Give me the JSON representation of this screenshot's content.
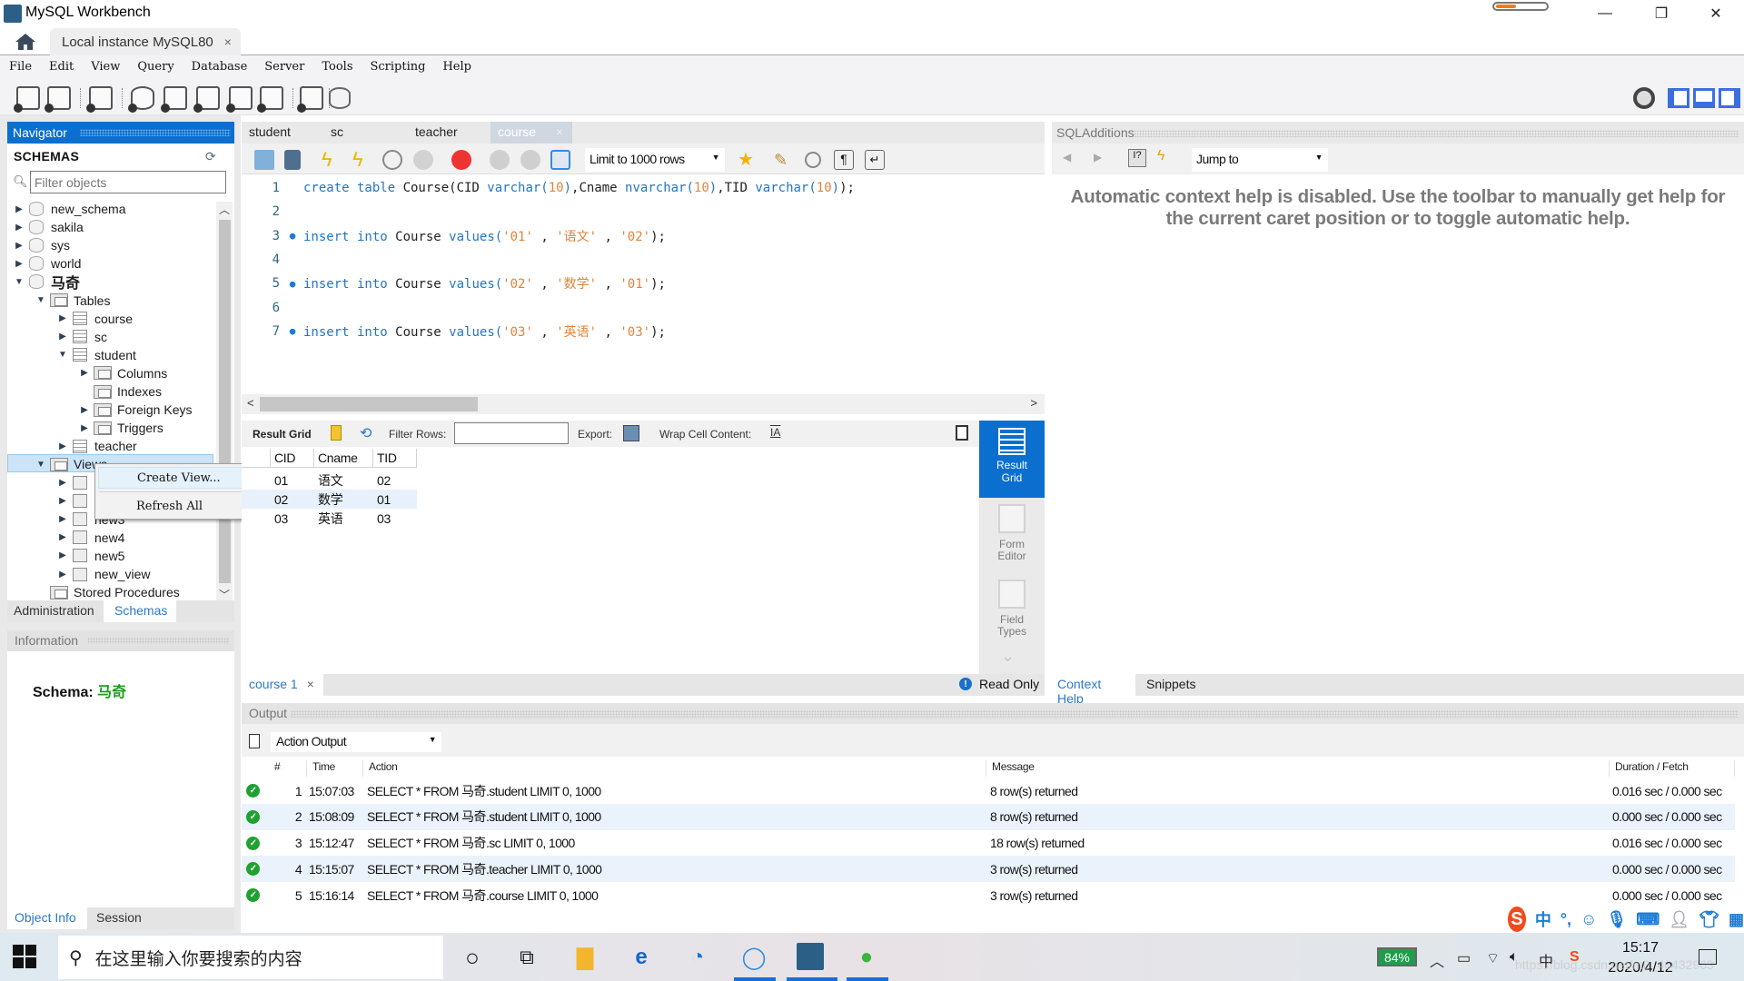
{
  "window": {
    "title": "MySQL Workbench",
    "progress_pct": 40,
    "minimize": "—",
    "restore": "❐",
    "close": "✕"
  },
  "connection_tab": {
    "label": "Local instance MySQL80",
    "close": "×"
  },
  "menu": [
    "File",
    "Edit",
    "View",
    "Query",
    "Database",
    "Server",
    "Tools",
    "Scripting",
    "Help"
  ],
  "navigator": {
    "header": "Navigator",
    "schemas_title": "SCHEMAS",
    "filter_placeholder": "Filter objects",
    "tree": [
      {
        "label": "new_schema",
        "level": 0,
        "expander": "▶",
        "icon": "database"
      },
      {
        "label": "sakila",
        "level": 0,
        "expander": "▶",
        "icon": "database"
      },
      {
        "label": "sys",
        "level": 0,
        "expander": "▶",
        "icon": "database"
      },
      {
        "label": "world",
        "level": 0,
        "expander": "▶",
        "icon": "database"
      },
      {
        "label": "马奇",
        "level": 0,
        "expander": "▼",
        "icon": "database",
        "bold": true
      },
      {
        "label": "Tables",
        "level": 1,
        "expander": "▼",
        "icon": "folder"
      },
      {
        "label": "course",
        "level": 2,
        "expander": "▶",
        "icon": "table"
      },
      {
        "label": "sc",
        "level": 2,
        "expander": "▶",
        "icon": "table"
      },
      {
        "label": "student",
        "level": 2,
        "expander": "▼",
        "icon": "table"
      },
      {
        "label": "Columns",
        "level": 3,
        "expander": "▶",
        "icon": "folder"
      },
      {
        "label": "Indexes",
        "level": 3,
        "expander": "",
        "icon": "folder"
      },
      {
        "label": "Foreign Keys",
        "level": 3,
        "expander": "▶",
        "icon": "folder"
      },
      {
        "label": "Triggers",
        "level": 3,
        "expander": "▶",
        "icon": "folder"
      },
      {
        "label": "teacher",
        "level": 2,
        "expander": "▶",
        "icon": "table"
      },
      {
        "label": "Views",
        "level": 1,
        "expander": "▼",
        "icon": "folder",
        "selected": true
      },
      {
        "label": "",
        "level": 2,
        "expander": "▶",
        "icon": "view"
      },
      {
        "label": "",
        "level": 2,
        "expander": "▶",
        "icon": "view"
      },
      {
        "label": "new3",
        "level": 2,
        "expander": "▶",
        "icon": "view"
      },
      {
        "label": "new4",
        "level": 2,
        "expander": "▶",
        "icon": "view"
      },
      {
        "label": "new5",
        "level": 2,
        "expander": "▶",
        "icon": "view"
      },
      {
        "label": "new_view",
        "level": 2,
        "expander": "▶",
        "icon": "view"
      },
      {
        "label": "Stored Procedures",
        "level": 1,
        "expander": "",
        "icon": "folder"
      }
    ],
    "bottom_tabs": {
      "administration": "Administration",
      "schemas": "Schemas"
    },
    "info_header": "Information",
    "schema_label": "Schema:",
    "schema_value": "马奇",
    "object_tabs": {
      "object_info": "Object Info",
      "session": "Session"
    }
  },
  "context_menu": {
    "items": [
      "Create View...",
      "Refresh All"
    ]
  },
  "editor": {
    "tabs": [
      {
        "label": "student",
        "active": false
      },
      {
        "label": "sc",
        "active": false
      },
      {
        "label": "teacher",
        "active": false
      },
      {
        "label": "course",
        "active": true
      }
    ],
    "tab_close": "×",
    "limit": "Limit to 1000 rows",
    "lines": [
      {
        "n": "1",
        "bp": "",
        "code": [
          [
            "kw",
            "create table "
          ],
          [
            "id",
            "Course(CID "
          ],
          [
            "kw",
            "varchar("
          ],
          [
            "num",
            "10"
          ],
          [
            "kw",
            ")"
          ],
          [
            "id",
            ",Cname "
          ],
          [
            "kw",
            "nvarchar("
          ],
          [
            "num",
            "10"
          ],
          [
            "kw",
            ")"
          ],
          [
            "id",
            ",TID "
          ],
          [
            "kw",
            "varchar("
          ],
          [
            "num",
            "10"
          ],
          [
            "kw",
            ")"
          ],
          [
            "id",
            ");"
          ]
        ]
      },
      {
        "n": "2",
        "bp": "",
        "code": []
      },
      {
        "n": "3",
        "bp": "●",
        "code": [
          [
            "kw",
            "insert into "
          ],
          [
            "id",
            "Course "
          ],
          [
            "kw",
            "values("
          ],
          [
            "str",
            "'01'"
          ],
          [
            "id",
            " , "
          ],
          [
            "str",
            "'语文'"
          ],
          [
            "id",
            " , "
          ],
          [
            "str",
            "'02'"
          ],
          [
            "id",
            ");"
          ]
        ]
      },
      {
        "n": "4",
        "bp": "",
        "code": []
      },
      {
        "n": "5",
        "bp": "●",
        "code": [
          [
            "kw",
            "insert into "
          ],
          [
            "id",
            "Course "
          ],
          [
            "kw",
            "values("
          ],
          [
            "str",
            "'02'"
          ],
          [
            "id",
            " , "
          ],
          [
            "str",
            "'数学'"
          ],
          [
            "id",
            " , "
          ],
          [
            "str",
            "'01'"
          ],
          [
            "id",
            ");"
          ]
        ]
      },
      {
        "n": "6",
        "bp": "",
        "code": []
      },
      {
        "n": "7",
        "bp": "●",
        "code": [
          [
            "kw",
            "insert into "
          ],
          [
            "id",
            "Course "
          ],
          [
            "kw",
            "values("
          ],
          [
            "str",
            "'03'"
          ],
          [
            "id",
            " , "
          ],
          [
            "str",
            "'英语'"
          ],
          [
            "id",
            " , "
          ],
          [
            "str",
            "'03'"
          ],
          [
            "id",
            ");"
          ]
        ]
      }
    ]
  },
  "result": {
    "toolbar": {
      "result_grid": "Result Grid",
      "filter_rows": "Filter Rows:",
      "filter_value": "",
      "export": "Export:",
      "wrap": "Wrap Cell Content:"
    },
    "columns": [
      "CID",
      "Cname",
      "TID"
    ],
    "rows": [
      [
        "01",
        "语文",
        "02"
      ],
      [
        "02",
        "数学",
        "01"
      ],
      [
        "03",
        "英语",
        "03"
      ]
    ],
    "side_buttons": [
      {
        "label_line1": "Result",
        "label_line2": "Grid",
        "active": true
      },
      {
        "label_line1": "Form",
        "label_line2": "Editor",
        "active": false
      },
      {
        "label_line1": "Field",
        "label_line2": "Types",
        "active": false
      }
    ],
    "status_tab": "course 1",
    "status_tab_close": "×",
    "read_only": "Read Only"
  },
  "sql_additions": {
    "header": "SQLAdditions",
    "jump_to": "Jump to",
    "help_text": "Automatic context help is disabled. Use the toolbar to manually get help for the current caret position or to toggle automatic help.",
    "tabs": {
      "context_help": "Context Help",
      "snippets": "Snippets"
    }
  },
  "output": {
    "header": "Output",
    "mode": "Action Output",
    "columns": {
      "num": "#",
      "time": "Time",
      "action": "Action",
      "message": "Message",
      "duration": "Duration / Fetch"
    },
    "rows": [
      {
        "num": "1",
        "time": "15:07:03",
        "action": "SELECT * FROM 马奇.student LIMIT 0, 1000",
        "message": "8 row(s) returned",
        "duration": "0.016 sec / 0.000 sec"
      },
      {
        "num": "2",
        "time": "15:08:09",
        "action": "SELECT * FROM 马奇.student LIMIT 0, 1000",
        "message": "8 row(s) returned",
        "duration": "0.000 sec / 0.000 sec"
      },
      {
        "num": "3",
        "time": "15:12:47",
        "action": "SELECT * FROM 马奇.sc LIMIT 0, 1000",
        "message": "18 row(s) returned",
        "duration": "0.016 sec / 0.000 sec"
      },
      {
        "num": "4",
        "time": "15:15:07",
        "action": "SELECT * FROM 马奇.teacher LIMIT 0, 1000",
        "message": "3 row(s) returned",
        "duration": "0.000 sec / 0.000 sec"
      },
      {
        "num": "5",
        "time": "15:16:14",
        "action": "SELECT * FROM 马奇.course LIMIT 0, 1000",
        "message": "3 row(s) returned",
        "duration": "0.000 sec / 0.000 sec"
      }
    ]
  },
  "ime": {
    "lang": "中",
    "punct": "°,",
    "logo": "S"
  },
  "taskbar": {
    "search_placeholder": "在这里输入你要搜索的内容",
    "battery": "84%",
    "tray_lang": "中",
    "time": "15:17",
    "date": "2020/4/12",
    "watermark": "https://blog.csdn.net/m0_46432963"
  },
  "colors": {
    "accent": "#0a6fcf",
    "keyword": "#2476c2",
    "string": "#e0843a",
    "ok": "#1fa12f"
  }
}
